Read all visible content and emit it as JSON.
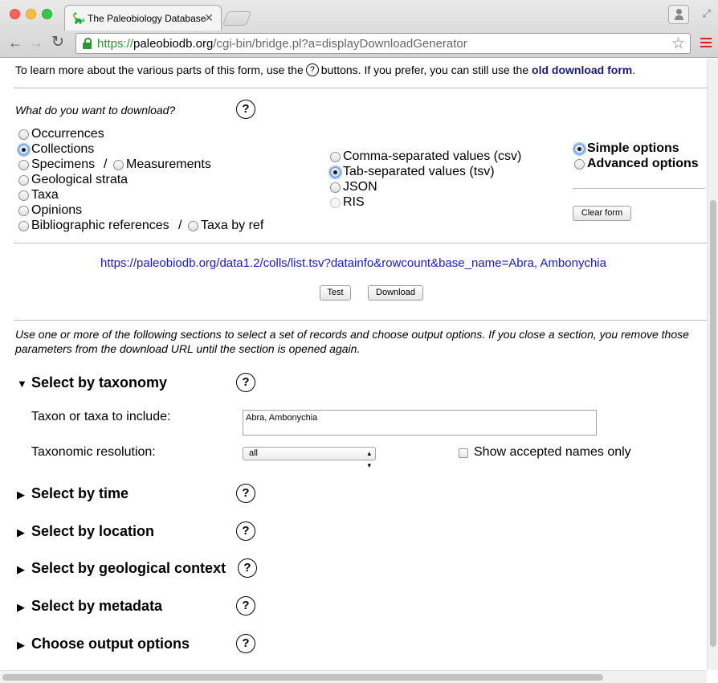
{
  "browser": {
    "tab_title": "The Paleobiology Database",
    "tab_favicon": "🦕",
    "url_scheme": "https",
    "url_host": "paleobiodb.org",
    "url_path": "/cgi-bin/bridge.pl?a=displayDownloadGenerator"
  },
  "intro": {
    "before": "To learn more about the various parts of this form, use the",
    "help_glyph": "?",
    "middle": "buttons. If you prefer, you can still use the",
    "link": "old download form",
    "after": "."
  },
  "what": {
    "question": "What do you want to download?",
    "help": "?",
    "record_types": [
      {
        "label": "Occurrences",
        "checked": false
      },
      {
        "label": "Collections",
        "checked": true
      },
      {
        "label": "Specimens",
        "checked": false
      },
      {
        "label": "Measurements",
        "checked": false
      },
      {
        "label": "Geological strata",
        "checked": false
      },
      {
        "label": "Taxa",
        "checked": false
      },
      {
        "label": "Opinions",
        "checked": false
      },
      {
        "label": "Bibliographic references",
        "checked": false
      },
      {
        "label": "Taxa by ref",
        "checked": false
      }
    ],
    "separator": "/",
    "formats": [
      {
        "label": "Comma-separated values (csv)",
        "checked": false
      },
      {
        "label": "Tab-separated values (tsv)",
        "checked": true
      },
      {
        "label": "JSON",
        "checked": false
      },
      {
        "label": "RIS",
        "checked": false,
        "disabled": true
      }
    ],
    "option_modes": [
      {
        "label": "Simple options",
        "checked": true
      },
      {
        "label": "Advanced options",
        "checked": false
      }
    ],
    "clear_button": "Clear form"
  },
  "generated_url": "https://paleobiodb.org/data1.2/colls/list.tsv?datainfo&rowcount&base_name=Abra, Ambonychia",
  "buttons": {
    "test": "Test",
    "download": "Download"
  },
  "sections_note": "Use one or more of the following sections to select a set of records and choose output options. If you close a section, you remove those parameters from the download URL until the section is opened again.",
  "sections": [
    {
      "title": "Select by taxonomy",
      "expanded": true,
      "help": "?"
    },
    {
      "title": "Select by time",
      "expanded": false,
      "help": "?"
    },
    {
      "title": "Select by location",
      "expanded": false,
      "help": "?"
    },
    {
      "title": "Select by geological context",
      "expanded": false,
      "help": "?"
    },
    {
      "title": "Select by metadata",
      "expanded": false,
      "help": "?"
    },
    {
      "title": "Choose output options",
      "expanded": false,
      "help": "?"
    }
  ],
  "taxonomy": {
    "taxa_label": "Taxon or taxa to include:",
    "taxa_value": "Abra, Ambonychia",
    "resolution_label": "Taxonomic resolution:",
    "resolution_value": "all",
    "accepted_label": "Show accepted names only"
  },
  "icons": {
    "expanded": "triangle-down-icon",
    "collapsed": "triangle-right-icon"
  }
}
